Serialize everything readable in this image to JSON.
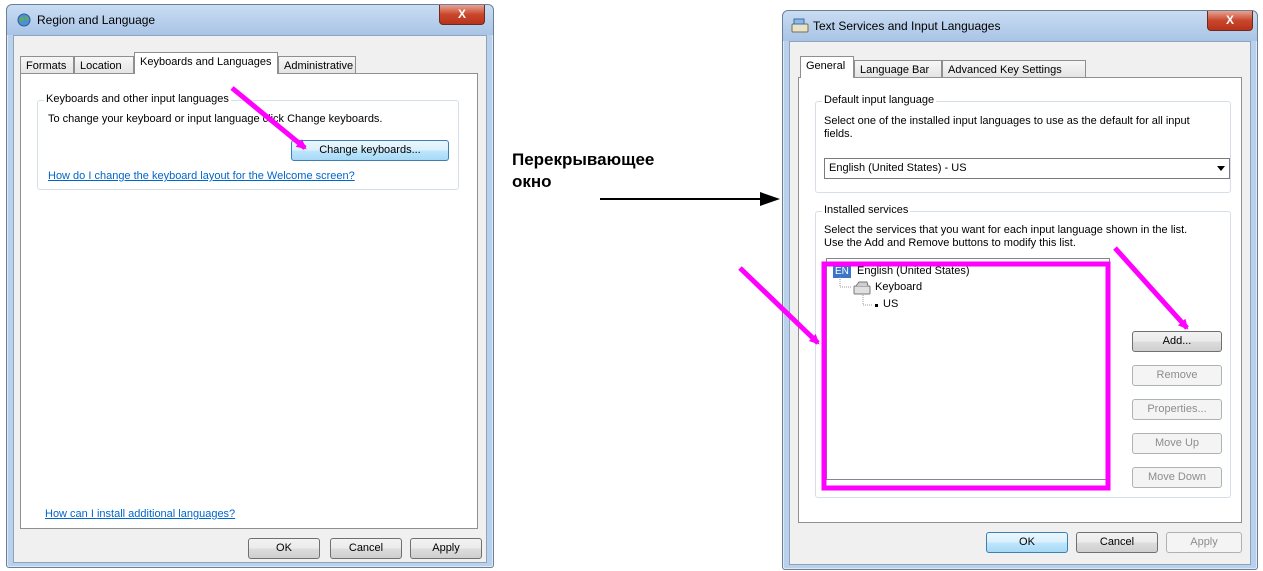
{
  "left_window": {
    "title": "Region and Language",
    "close_glyph": "X",
    "tabs": [
      "Formats",
      "Location",
      "Keyboards and Languages",
      "Administrative"
    ],
    "group_title": "Keyboards and other input languages",
    "instruction": "To change your keyboard or input language click Change keyboards.",
    "change_keyboards_button": "Change keyboards...",
    "welcome_link": "How do I change the keyboard layout for the Welcome screen?",
    "install_link": "How can I install additional languages?",
    "ok_button": "OK",
    "cancel_button": "Cancel",
    "apply_button": "Apply"
  },
  "annotation": {
    "line1": "Перекрывающее",
    "line2": "окно"
  },
  "right_window": {
    "title": "Text Services and Input Languages",
    "close_glyph": "X",
    "tabs": [
      "General",
      "Language Bar",
      "Advanced Key Settings"
    ],
    "default_group_title": "Default input language",
    "default_description_line1": "Select one of the installed input languages to use as the default for all input",
    "default_description_line2": "fields.",
    "default_select_value": "English (United States) - US",
    "installed_group_title": "Installed services",
    "installed_description_line1": "Select the services that you want for each input language shown in the list.",
    "installed_description_line2": "Use the Add and Remove buttons to modify this list.",
    "tree": {
      "language_badge": "EN",
      "language": "English (United States)",
      "category": "Keyboard",
      "layout": "US"
    },
    "add_button": "Add...",
    "remove_button": "Remove",
    "properties_button": "Properties...",
    "move_up_button": "Move Up",
    "move_down_button": "Move Down",
    "ok_button": "OK",
    "cancel_button": "Cancel",
    "apply_button": "Apply"
  },
  "colors": {
    "highlight": "#ff00ff",
    "link": "#0066cc",
    "badge": "#3c74c9"
  }
}
